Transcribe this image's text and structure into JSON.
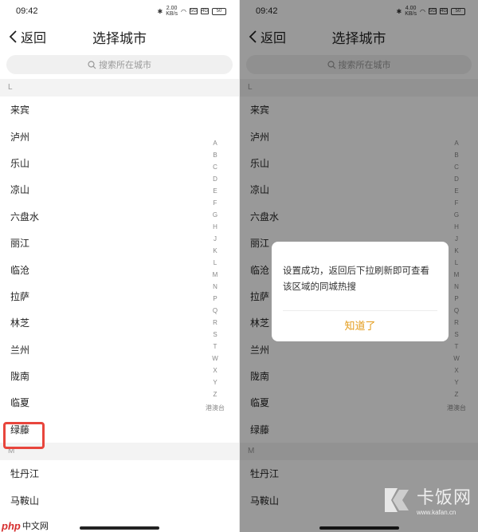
{
  "status": {
    "time": "09:42",
    "net_left": "2.00\nKB/s",
    "net_right": "4.00\nKB/s",
    "sig1": "5G",
    "sig2": "4G",
    "battery": "50"
  },
  "nav": {
    "back_label": "返回",
    "title": "选择城市"
  },
  "search": {
    "placeholder": "搜索所在城市"
  },
  "sections": {
    "L": "L",
    "M": "M"
  },
  "cities_L": [
    "来宾",
    "泸州",
    "乐山",
    "凉山",
    "六盘水",
    "丽江",
    "临沧",
    "拉萨",
    "林芝",
    "兰州",
    "陇南",
    "临夏",
    "绿藤"
  ],
  "cities_M": [
    "牡丹江",
    "马鞍山"
  ],
  "index_letters": [
    "A",
    "B",
    "C",
    "D",
    "E",
    "F",
    "G",
    "H",
    "J",
    "K",
    "L",
    "M",
    "N",
    "P",
    "Q",
    "R",
    "S",
    "T",
    "W",
    "X",
    "Y",
    "Z"
  ],
  "index_hot": "港澳台",
  "dialog": {
    "message": "设置成功，返回后下拉刷新即可查看该区域的同城热搜",
    "ok": "知道了"
  },
  "watermark_left": {
    "logo": "php",
    "text": "中文网"
  },
  "watermark_right": {
    "big": "卡饭网",
    "small": "www.kafan.cn"
  },
  "colors": {
    "highlight": "#e8453c",
    "dialog_button": "#e39b1a"
  }
}
